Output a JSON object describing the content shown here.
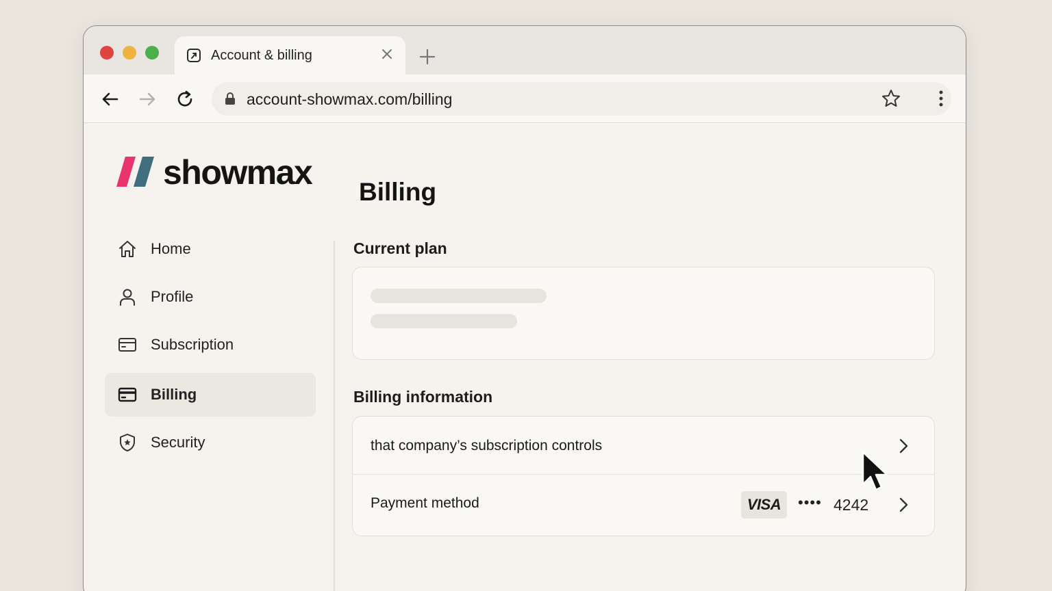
{
  "browser": {
    "tab_title": "Account & billing",
    "url": "account-showmax.com/billing"
  },
  "brand": {
    "name": "showmax",
    "colors": {
      "stripe_pink": "#e8346f",
      "stripe_teal": "#3f6f7e"
    }
  },
  "sidebar": {
    "items": [
      {
        "label": "Home",
        "icon": "home-icon",
        "active": false
      },
      {
        "label": "Profile",
        "icon": "user-icon",
        "active": false
      },
      {
        "label": "Subscription",
        "icon": "card-icon",
        "active": false
      },
      {
        "label": "Billing",
        "icon": "credit-card-icon",
        "active": true
      },
      {
        "label": "Security",
        "icon": "shield-icon",
        "active": false
      }
    ]
  },
  "main": {
    "title": "Billing",
    "current_plan": {
      "heading": "Current plan",
      "loading": true
    },
    "billing_info": {
      "heading": "Billing information",
      "rows": [
        {
          "label": "that company’s subscription controls"
        },
        {
          "label": "Payment method",
          "card_brand": "VISA",
          "masked": "••••",
          "last4": "4242"
        }
      ]
    }
  }
}
